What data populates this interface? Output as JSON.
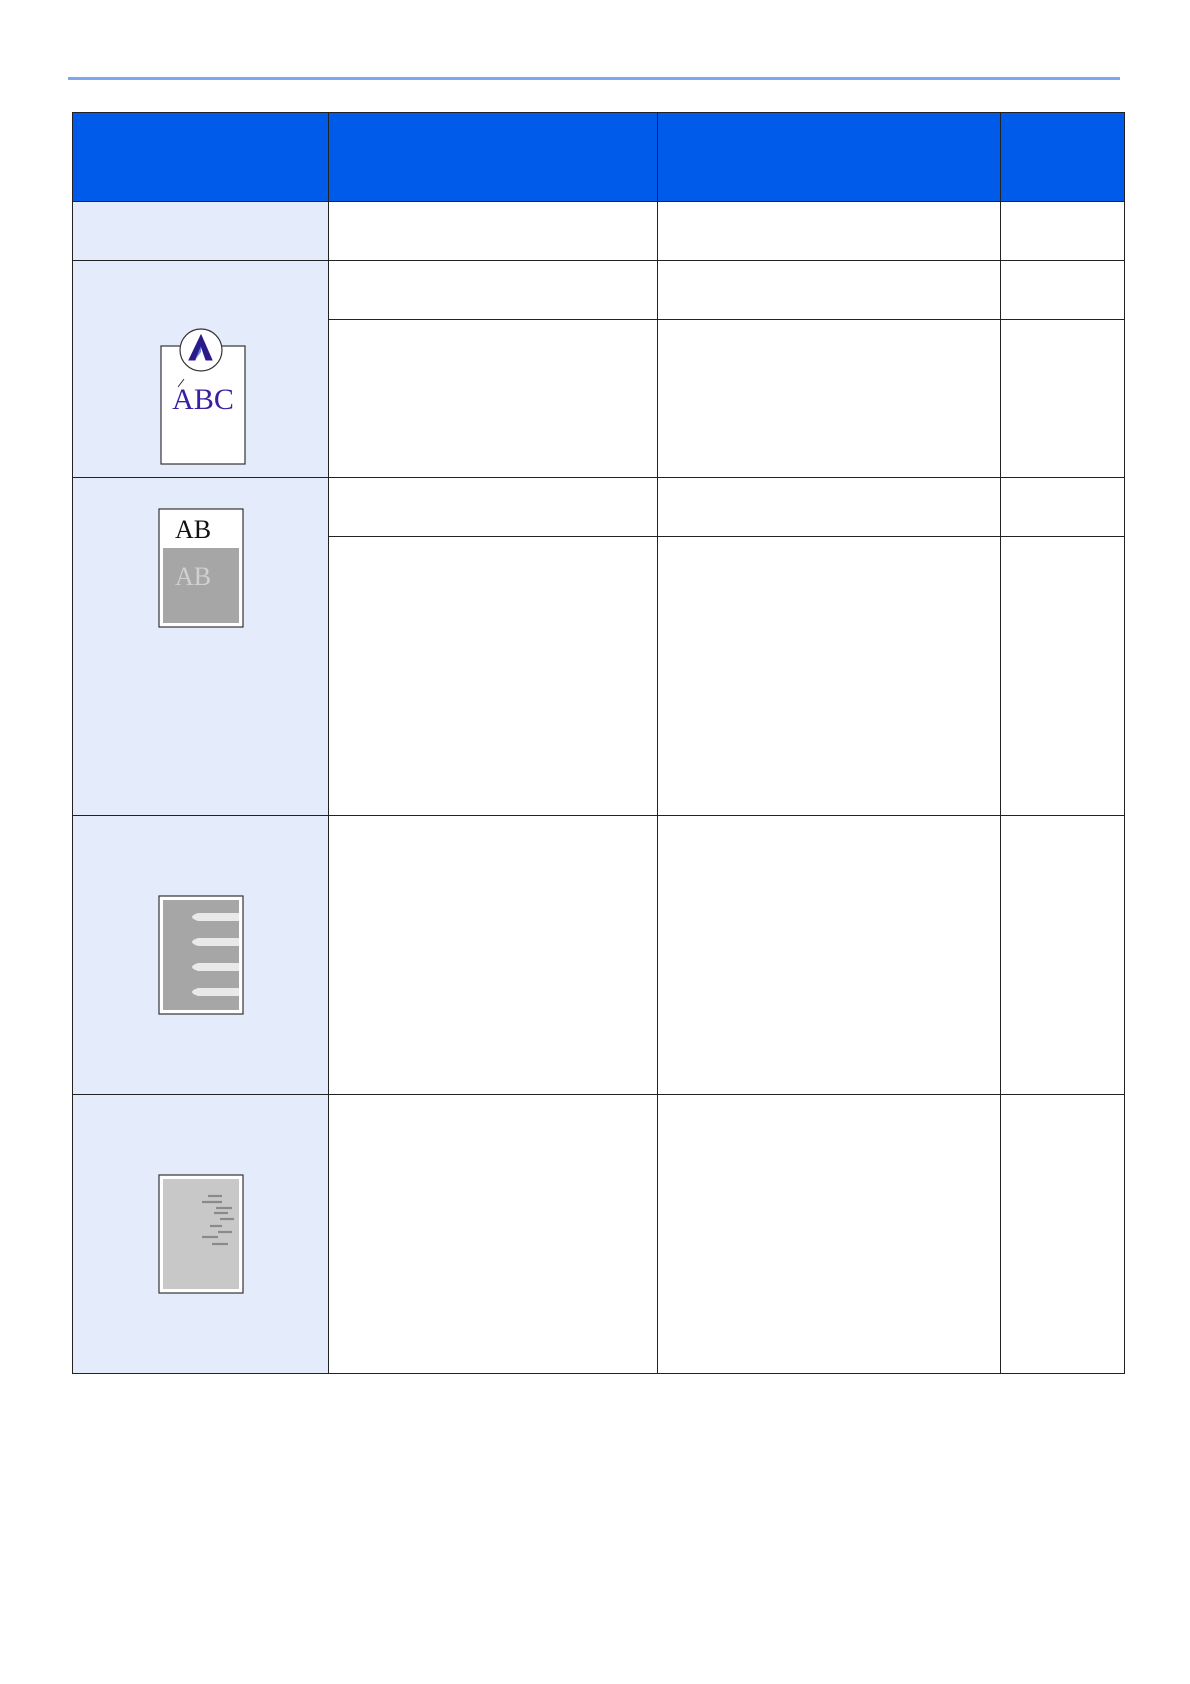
{
  "page": {
    "accent_rule_color": "#7fa7ef",
    "header_color": "#005bea",
    "symptom_cell_color": "#e4ebfb"
  },
  "table": {
    "header_cells": [
      "",
      "",
      "",
      ""
    ],
    "illustrations": {
      "blurred_text": {
        "icon": "magnifier-abc-icon",
        "text": "ABC",
        "text_color": "#3a1fa0"
      },
      "gray_background": {
        "icon": "gray-background-page-icon",
        "clean_text": "AB",
        "faded_text": "AB",
        "shade_color": "#a7a6a6"
      },
      "white_streaks": {
        "icon": "white-streaks-page-icon",
        "shade_color": "#a7a6a6"
      },
      "dirty_marks": {
        "icon": "dirty-marks-page-icon",
        "shade_color": "#c8c8c8"
      }
    }
  }
}
